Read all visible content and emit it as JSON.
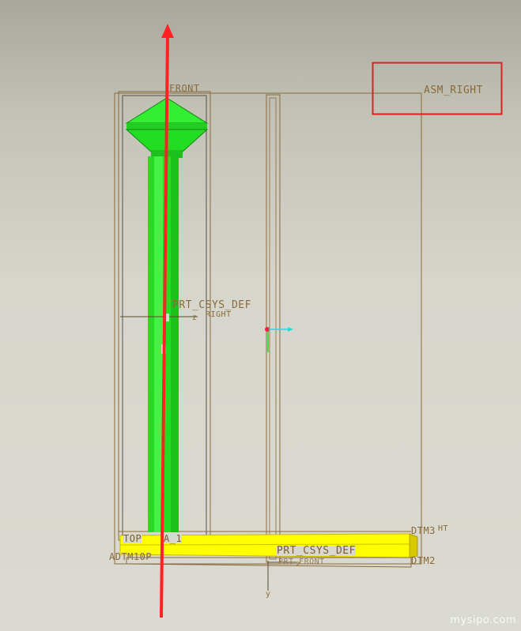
{
  "viewport": {
    "background_top": "#a7a79b",
    "background_bottom": "#dadad2",
    "datum_color": "#8a6a3a",
    "part_color": "#22dd22",
    "base_color": "#ffff00",
    "axis_color": "#ff2222",
    "highlight_color": "#e02020"
  },
  "labels": {
    "front": "FRONT",
    "asm_right": "ASM_RIGHT",
    "prt_csys_def_top": "PRT_CSYS_DEF",
    "right_partial": "RIGHT",
    "csys_z_top": "z",
    "top": "TOP",
    "a1": "A_1",
    "adtm10p": "ADTM10P",
    "prt_csys_def_bottom": "PRT_CSYS_DEF",
    "front_partial_bottom": "PRT_FRONT",
    "csys_z_bottom": "z",
    "csys_y_bottom": "y",
    "dtm3": "DTM3",
    "dtm_right_overlap": "HT",
    "dtm2": "DTM2"
  },
  "watermark": "mysipo.com"
}
